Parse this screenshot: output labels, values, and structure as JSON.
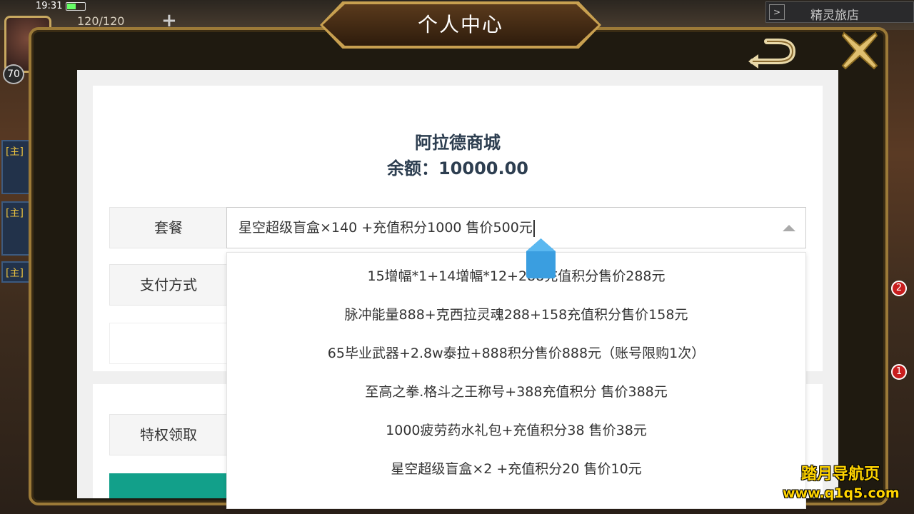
{
  "status_bar": {
    "time": "19:31"
  },
  "hud": {
    "energy": "120/120",
    "level": "70",
    "inn_label": "精灵旅店",
    "left_quests": [
      "[主]",
      "[主]",
      "[主]"
    ],
    "right_badges": [
      "2",
      "1"
    ]
  },
  "dialog": {
    "title": "个人中心"
  },
  "shop": {
    "name": "阿拉德商城",
    "balance": "余额：10000.00"
  },
  "form": {
    "package_label": "套餐",
    "selected_package": "星空超级盲盒×140 +充值积分1000 售价500元",
    "payment_label": "支付方式",
    "privilege_label": "特权领取"
  },
  "dropdown_options": [
    "15增幅*1+14增幅*12+288充值积分售价288元",
    "脉冲能量888+克西拉灵魂288+158充值积分售价158元",
    "65毕业武器+2.8w泰拉+888积分售价888元（账号限购1次）",
    "至高之拳.格斗之王称号+388充值积分 售价388元",
    "1000疲劳药水礼包+充值积分38 售价38元",
    "星空超级盲盒×2 +充值积分20 售价10元"
  ],
  "watermark": {
    "line1": "踏月导航页",
    "line2": "www.q1q5.com"
  },
  "colors": {
    "frame_gold": "#9c7a38",
    "text_dark_blue": "#2d3e50",
    "teal": "#12a08a",
    "handle_blue": "#3a9ee0"
  }
}
